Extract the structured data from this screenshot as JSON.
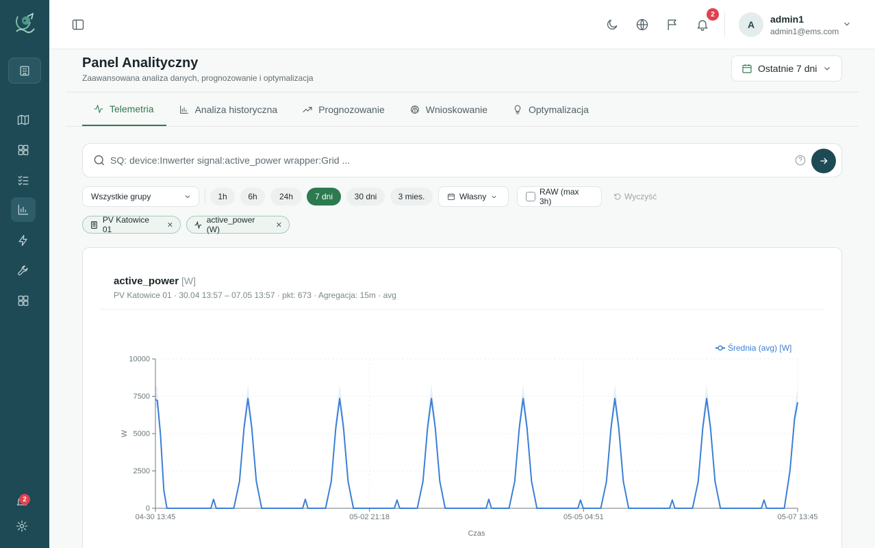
{
  "topbar": {
    "notif_count": "2",
    "user_initial": "A",
    "user_name": "admin1",
    "user_email": "admin1@ems.com"
  },
  "sidebar": {
    "notif_count": "2"
  },
  "page": {
    "title": "Panel Analityczny",
    "subtitle": "Zaawansowana analiza danych, prognozowanie i optymalizacja",
    "range_label": "Ostatnie 7 dni"
  },
  "tabs": [
    {
      "label": "Telemetria",
      "icon": "activity-icon",
      "active": true
    },
    {
      "label": "Analiza historyczna",
      "icon": "bar-chart-icon"
    },
    {
      "label": "Prognozowanie",
      "icon": "trending-up-icon"
    },
    {
      "label": "Wnioskowanie",
      "icon": "brain-icon"
    },
    {
      "label": "Optymalizacja",
      "icon": "lightbulb-icon"
    }
  ],
  "search": {
    "placeholder": "SQ: device:Inwerter signal:active_power wrapper:Grid ..."
  },
  "filters": {
    "group_select": "Wszystkie grupy",
    "ranges": [
      "1h",
      "6h",
      "24h",
      "7 dni",
      "30 dni",
      "3 mies."
    ],
    "active_range": "7 dni",
    "custom_label": "Własny",
    "raw_label": "RAW (max 3h)",
    "clear_label": "Wyczyść"
  },
  "chips": [
    {
      "label": "PV Katowice 01",
      "icon": "device-icon"
    },
    {
      "label": "active_power (W)",
      "icon": "activity-icon"
    }
  ],
  "card": {
    "title": "active_power",
    "unit": "[W]",
    "meta": "PV Katowice 01 · 30.04 13:57 – 07.05 13:57 · pkt: 673 · Agregacja: 15m · avg"
  },
  "colors": {
    "primary": "#1e4a55",
    "accent": "#2c7a4f",
    "series": "#3a7fd5",
    "badge": "#e0414e"
  },
  "chart_data": {
    "type": "line",
    "title": "active_power [W]",
    "xlabel": "Czas",
    "ylabel": "W",
    "ylim": [
      0,
      10000
    ],
    "yticks": [
      0,
      2500,
      5000,
      7500,
      10000
    ],
    "xticks": [
      "04-30 13:45",
      "05-02 21:18",
      "05-05 04:51",
      "05-07 13:45"
    ],
    "x_range_hours": [
      0,
      168
    ],
    "legend": "top-right",
    "series": [
      {
        "name": "Średnia (avg) [W]",
        "points": [
          [
            0,
            7300
          ],
          [
            0.5,
            7200
          ],
          [
            1.3,
            5000
          ],
          [
            2.2,
            1200
          ],
          [
            3.0,
            0
          ],
          [
            14.5,
            0
          ],
          [
            15.2,
            600
          ],
          [
            15.9,
            0
          ],
          [
            20.5,
            0
          ],
          [
            22.0,
            1800
          ],
          [
            23.2,
            5400
          ],
          [
            24.2,
            7350
          ],
          [
            25.2,
            5400
          ],
          [
            26.4,
            1800
          ],
          [
            27.8,
            0
          ],
          [
            38.5,
            0
          ],
          [
            39.2,
            600
          ],
          [
            39.9,
            0
          ],
          [
            44.5,
            0
          ],
          [
            46.0,
            1800
          ],
          [
            47.2,
            5400
          ],
          [
            48.2,
            7350
          ],
          [
            49.2,
            5400
          ],
          [
            50.4,
            1800
          ],
          [
            51.8,
            0
          ],
          [
            62.5,
            0
          ],
          [
            63.2,
            550
          ],
          [
            63.9,
            0
          ],
          [
            68.5,
            0
          ],
          [
            70.0,
            1800
          ],
          [
            71.2,
            5400
          ],
          [
            72.2,
            7350
          ],
          [
            73.2,
            5400
          ],
          [
            74.4,
            1800
          ],
          [
            75.8,
            0
          ],
          [
            86.5,
            0
          ],
          [
            87.2,
            600
          ],
          [
            87.9,
            0
          ],
          [
            92.5,
            0
          ],
          [
            94.0,
            1800
          ],
          [
            95.2,
            5400
          ],
          [
            96.2,
            7350
          ],
          [
            97.2,
            5400
          ],
          [
            98.4,
            1800
          ],
          [
            99.8,
            0
          ],
          [
            110.5,
            0
          ],
          [
            111.2,
            550
          ],
          [
            111.9,
            0
          ],
          [
            116.5,
            0
          ],
          [
            118.0,
            1800
          ],
          [
            119.2,
            5400
          ],
          [
            120.2,
            7350
          ],
          [
            121.2,
            5400
          ],
          [
            122.4,
            1800
          ],
          [
            123.8,
            0
          ],
          [
            134.5,
            0
          ],
          [
            135.2,
            550
          ],
          [
            135.9,
            0
          ],
          [
            140.5,
            0
          ],
          [
            142.0,
            1800
          ],
          [
            143.2,
            5400
          ],
          [
            144.2,
            7350
          ],
          [
            145.2,
            5400
          ],
          [
            146.4,
            1800
          ],
          [
            147.8,
            0
          ],
          [
            158.5,
            0
          ],
          [
            159.2,
            550
          ],
          [
            159.9,
            0
          ],
          [
            164.5,
            0
          ],
          [
            166.0,
            2500
          ],
          [
            167.2,
            6000
          ],
          [
            168,
            7100
          ]
        ]
      }
    ]
  }
}
